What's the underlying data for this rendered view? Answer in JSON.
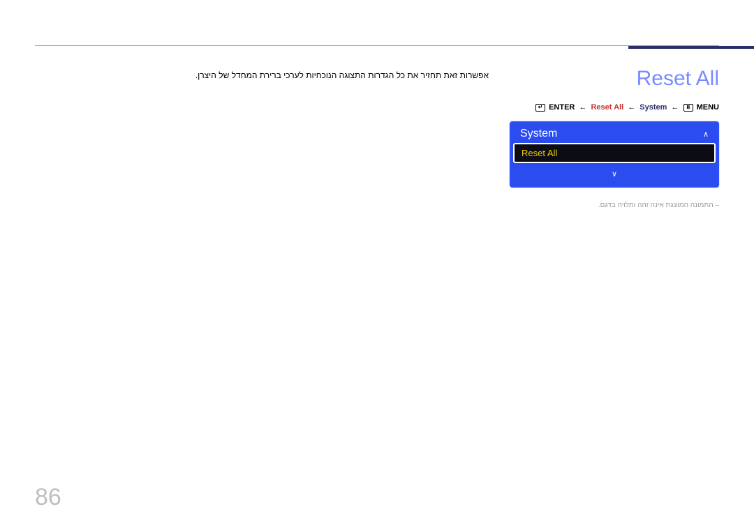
{
  "page_number": "86",
  "title": "Reset All",
  "breadcrumb": {
    "enter_label": "ENTER",
    "item1": "Reset All",
    "item2": "System",
    "menu_label": "MENU"
  },
  "menu": {
    "header": "System",
    "selected": "Reset All"
  },
  "caption": "התמונה המוצגת אינה זהה ותלויה בדגם.",
  "description": "אפשרות זאת תחזיר את כל הגדרות התצוגה הנוכחיות לערכי ברירת המחדל של היצרן."
}
